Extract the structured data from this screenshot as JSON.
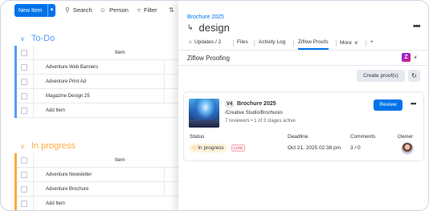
{
  "toolbar": {
    "new_item": "New Item",
    "search": "Search",
    "person": "Person",
    "filter": "Filter"
  },
  "board": {
    "groups": [
      {
        "title": "To-Do",
        "color": "#579bfc",
        "column_header": "Item",
        "items": [
          "Adventure Web Banners",
          "Adventure Print Ad",
          "Magazine Design 25"
        ],
        "add_item": "Add Item"
      },
      {
        "title": "In progress",
        "color": "#fdab3d",
        "column_header": "Item",
        "items": [
          "Adventure Newsletter",
          "Adventure Brochure"
        ],
        "add_item": "Add Item"
      }
    ]
  },
  "panel": {
    "breadcrumb": "Brochure 2025",
    "title": "design",
    "tabs": [
      "Updates / 2",
      "Files",
      "Activity Log",
      "Ziflow Proofs",
      "More",
      "+"
    ],
    "active_tab": "Ziflow Proofs",
    "app_name": "Ziflow Proofing",
    "create_proof": "Create proof(s)",
    "proof": {
      "version": "V4",
      "name": "Brochure 2025",
      "path": "/Creative Studio/Brochures",
      "meta": "7 reviewers • 1 of 3 stages active",
      "review": "Review",
      "columns": {
        "status": "Status",
        "deadline": "Deadline",
        "comments": "Comments",
        "owner": "Owner"
      },
      "status": "In progress",
      "late": "LATE",
      "deadline": "Oct 21, 2025 02:38 pm",
      "comments": "3 / 0"
    }
  },
  "colors": {
    "accent": "#0073ea",
    "todo": "#579bfc",
    "in_progress": "#fdab3d",
    "late": "#e2445c"
  }
}
